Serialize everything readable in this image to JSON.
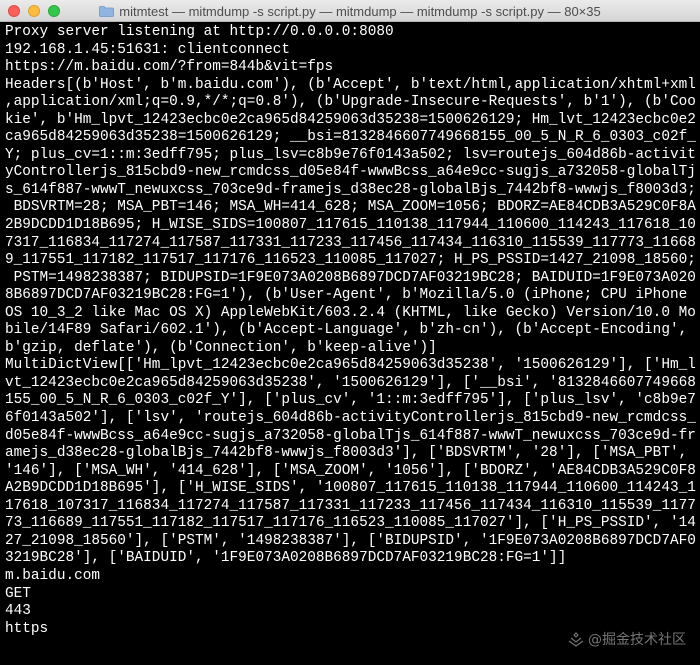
{
  "window": {
    "title": "mitmtest — mitmdump -s script.py — mitmdump — mitmdump -s script.py — 80×35"
  },
  "terminal": {
    "lines": [
      "Proxy server listening at http://0.0.0.0:8080",
      "192.168.1.45:51631: clientconnect",
      "https://m.baidu.com/?from=844b&vit=fps",
      "Headers[(b'Host', b'm.baidu.com'), (b'Accept', b'text/html,application/xhtml+xml",
      ",application/xml;q=0.9,*/*;q=0.8'), (b'Upgrade-Insecure-Requests', b'1'), (b'Coo",
      "kie', b'Hm_lpvt_12423ecbc0e2ca965d84259063d35238=1500626129; Hm_lvt_12423ecbc0e2",
      "ca965d84259063d35238=1500626129; __bsi=8132846607749668155_00_5_N_R_6_0303_c02f_",
      "Y; plus_cv=1::m:3edff795; plus_lsv=c8b9e76f0143a502; lsv=routejs_604d86b-activit",
      "yControllerjs_815cbd9-new_rcmdcss_d05e84f-wwwBcss_a64e9cc-sugjs_a732058-globalTj",
      "s_614f887-wwwT_newuxcss_703ce9d-framejs_d38ec28-globalBjs_7442bf8-wwwjs_f8003d3;",
      " BDSVRTM=28; MSA_PBT=146; MSA_WH=414_628; MSA_ZOOM=1056; BDORZ=AE84CDB3A529C0F8A",
      "2B9DCDD1D18B695; H_WISE_SIDS=100807_117615_110138_117944_110600_114243_117618_10",
      "7317_116834_117274_117587_117331_117233_117456_117434_116310_115539_117773_11668",
      "9_117551_117182_117517_117176_116523_110085_117027; H_PS_PSSID=1427_21098_18560;",
      " PSTM=1498238387; BIDUPSID=1F9E073A0208B6897DCD7AF03219BC28; BAIDUID=1F9E073A020",
      "8B6897DCD7AF03219BC28:FG=1'), (b'User-Agent', b'Mozilla/5.0 (iPhone; CPU iPhone",
      "OS 10_3_2 like Mac OS X) AppleWebKit/603.2.4 (KHTML, like Gecko) Version/10.0 Mo",
      "bile/14F89 Safari/602.1'), (b'Accept-Language', b'zh-cn'), (b'Accept-Encoding',",
      "b'gzip, deflate'), (b'Connection', b'keep-alive')]",
      "MultiDictView[['Hm_lpvt_12423ecbc0e2ca965d84259063d35238', '1500626129'], ['Hm_l",
      "vt_12423ecbc0e2ca965d84259063d35238', '1500626129'], ['__bsi', '8132846607749668",
      "155_00_5_N_R_6_0303_c02f_Y'], ['plus_cv', '1::m:3edff795'], ['plus_lsv', 'c8b9e7",
      "6f0143a502'], ['lsv', 'routejs_604d86b-activityControllerjs_815cbd9-new_rcmdcss_",
      "d05e84f-wwwBcss_a64e9cc-sugjs_a732058-globalTjs_614f887-wwwT_newuxcss_703ce9d-fr",
      "amejs_d38ec28-globalBjs_7442bf8-wwwjs_f8003d3'], ['BDSVRTM', '28'], ['MSA_PBT',",
      "'146'], ['MSA_WH', '414_628'], ['MSA_ZOOM', '1056'], ['BDORZ', 'AE84CDB3A529C0F8",
      "A2B9DCDD1D18B695'], ['H_WISE_SIDS', '100807_117615_110138_117944_110600_114243_1",
      "17618_107317_116834_117274_117587_117331_117233_117456_117434_116310_115539_1177",
      "73_116689_117551_117182_117517_117176_116523_110085_117027'], ['H_PS_PSSID', '14",
      "27_21098_18560'], ['PSTM', '1498238387'], ['BIDUPSID', '1F9E073A0208B6897DCD7AF0",
      "3219BC28'], ['BAIDUID', '1F9E073A0208B6897DCD7AF03219BC28:FG=1']]",
      "m.baidu.com",
      "GET",
      "443",
      "https"
    ]
  },
  "watermark": {
    "text": "@掘金技术社区"
  }
}
